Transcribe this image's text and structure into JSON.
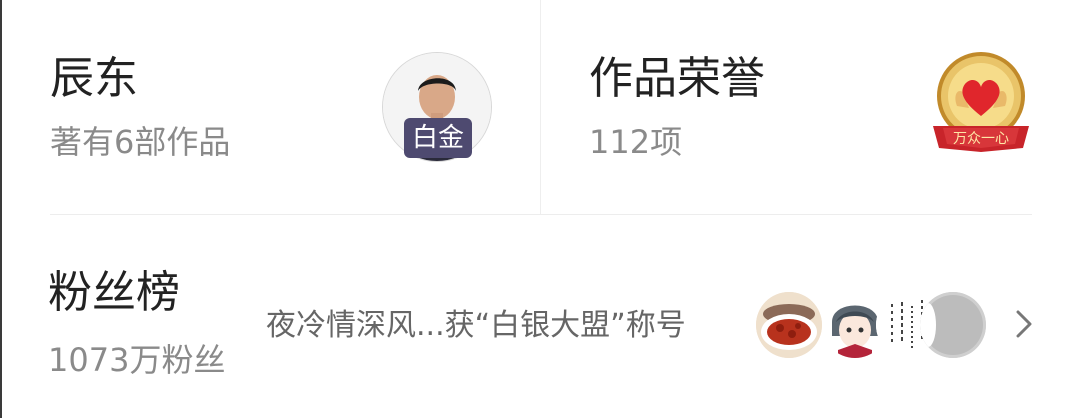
{
  "author": {
    "name": "辰东",
    "works": "著有6部作品",
    "badge": "白金"
  },
  "honors": {
    "title": "作品荣誉",
    "count": "112项",
    "medal_text": "万众一心"
  },
  "fans": {
    "title": "粉丝榜",
    "count": "1073万粉丝",
    "message": "夜冷情深风...获“白银大盟”称号",
    "avatar_icons": [
      "food-avatar-icon",
      "anime-boy-avatar-icon",
      "calligraphy-avatar-icon",
      "gray-disc-avatar-icon"
    ]
  },
  "colors": {
    "badge": "#4e4a70",
    "medal_gold": "#d9a53b",
    "medal_red": "#e0262c",
    "secondary_text": "#8a8a8a"
  }
}
